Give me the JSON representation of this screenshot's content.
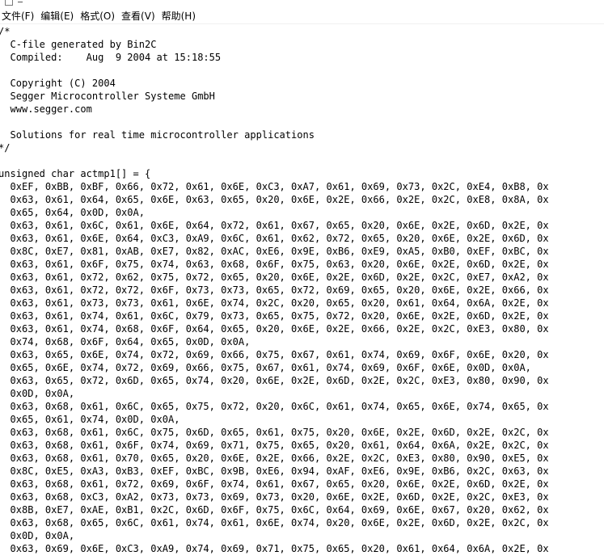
{
  "menu": {
    "items": [
      "文件(F)",
      "编辑(E)",
      "格式(O)",
      "查看(V)",
      "帮助(H)"
    ]
  },
  "editor": {
    "lines": [
      "/*",
      "  C-file generated by Bin2C",
      "  Compiled:    Aug  9 2004 at 15:18:55",
      "",
      "  Copyright (C) 2004",
      "  Segger Microcontroller Systeme GmbH",
      "  www.segger.com",
      "",
      "  Solutions for real time microcontroller applications",
      "*/",
      "",
      "unsigned char actmp1[] = {",
      "  0xEF, 0xBB, 0xBF, 0x66, 0x72, 0x61, 0x6E, 0xC3, 0xA7, 0x61, 0x69, 0x73, 0x2C, 0xE4, 0xB8, 0x",
      "  0x63, 0x61, 0x64, 0x65, 0x6E, 0x63, 0x65, 0x20, 0x6E, 0x2E, 0x66, 0x2E, 0x2C, 0xE8, 0x8A, 0x",
      "  0x65, 0x64, 0x0D, 0x0A,",
      "  0x63, 0x61, 0x6C, 0x61, 0x6E, 0x64, 0x72, 0x61, 0x67, 0x65, 0x20, 0x6E, 0x2E, 0x6D, 0x2E, 0x",
      "  0x63, 0x61, 0x6E, 0x64, 0xC3, 0xA9, 0x6C, 0x61, 0x62, 0x72, 0x65, 0x20, 0x6E, 0x2E, 0x6D, 0x",
      "  0x8C, 0xE7, 0x81, 0xAB, 0xE7, 0x82, 0xAC, 0xE6, 0x9E, 0xB6, 0xE9, 0xA5, 0xB0, 0xEF, 0xBC, 0x",
      "  0x63, 0x61, 0x6F, 0x75, 0x74, 0x63, 0x68, 0x6F, 0x75, 0x63, 0x20, 0x6E, 0x2E, 0x6D, 0x2E, 0x",
      "  0x63, 0x61, 0x72, 0x62, 0x75, 0x72, 0x65, 0x20, 0x6E, 0x2E, 0x6D, 0x2E, 0x2C, 0xE7, 0xA2, 0x",
      "  0x63, 0x61, 0x72, 0x72, 0x6F, 0x73, 0x73, 0x65, 0x72, 0x69, 0x65, 0x20, 0x6E, 0x2E, 0x66, 0x",
      "  0x63, 0x61, 0x73, 0x73, 0x61, 0x6E, 0x74, 0x2C, 0x20, 0x65, 0x20, 0x61, 0x64, 0x6A, 0x2E, 0x",
      "  0x63, 0x61, 0x74, 0x61, 0x6C, 0x79, 0x73, 0x65, 0x75, 0x72, 0x20, 0x6E, 0x2E, 0x6D, 0x2E, 0x",
      "  0x63, 0x61, 0x74, 0x68, 0x6F, 0x64, 0x65, 0x20, 0x6E, 0x2E, 0x66, 0x2E, 0x2C, 0xE3, 0x80, 0x",
      "  0x74, 0x68, 0x6F, 0x64, 0x65, 0x0D, 0x0A,",
      "  0x63, 0x65, 0x6E, 0x74, 0x72, 0x69, 0x66, 0x75, 0x67, 0x61, 0x74, 0x69, 0x6F, 0x6E, 0x20, 0x",
      "  0x65, 0x6E, 0x74, 0x72, 0x69, 0x66, 0x75, 0x67, 0x61, 0x74, 0x69, 0x6F, 0x6E, 0x0D, 0x0A,",
      "  0x63, 0x65, 0x72, 0x6D, 0x65, 0x74, 0x20, 0x6E, 0x2E, 0x6D, 0x2E, 0x2C, 0xE3, 0x80, 0x90, 0x",
      "  0x0D, 0x0A,",
      "  0x63, 0x68, 0x61, 0x6C, 0x65, 0x75, 0x72, 0x20, 0x6C, 0x61, 0x74, 0x65, 0x6E, 0x74, 0x65, 0x",
      "  0x65, 0x61, 0x74, 0x0D, 0x0A,",
      "  0x63, 0x68, 0x61, 0x6C, 0x75, 0x6D, 0x65, 0x61, 0x75, 0x20, 0x6E, 0x2E, 0x6D, 0x2E, 0x2C, 0x",
      "  0x63, 0x68, 0x61, 0x6F, 0x74, 0x69, 0x71, 0x75, 0x65, 0x20, 0x61, 0x64, 0x6A, 0x2E, 0x2C, 0x",
      "  0x63, 0x68, 0x61, 0x70, 0x65, 0x20, 0x6E, 0x2E, 0x66, 0x2E, 0x2C, 0xE3, 0x80, 0x90, 0xE5, 0x",
      "  0x8C, 0xE5, 0xA3, 0xB3, 0xEF, 0xBC, 0x9B, 0xE6, 0x94, 0xAF, 0xE6, 0x9E, 0xB6, 0x2C, 0x63, 0x",
      "  0x63, 0x68, 0x61, 0x72, 0x69, 0x6F, 0x74, 0x61, 0x67, 0x65, 0x20, 0x6E, 0x2E, 0x6D, 0x2E, 0x",
      "  0x63, 0x68, 0xC3, 0xA2, 0x73, 0x73, 0x69, 0x73, 0x20, 0x6E, 0x2E, 0x6D, 0x2E, 0x2C, 0xE3, 0x",
      "  0x8B, 0xE7, 0xAE, 0xB1, 0x2C, 0x6D, 0x6F, 0x75, 0x6C, 0x64, 0x69, 0x6E, 0x67, 0x20, 0x62, 0x",
      "  0x63, 0x68, 0x65, 0x6C, 0x61, 0x74, 0x61, 0x6E, 0x74, 0x20, 0x6E, 0x2E, 0x6D, 0x2E, 0x2C, 0x",
      "  0x0D, 0x0A,",
      "  0x63, 0x69, 0x6E, 0xC3, 0xA9, 0x74, 0x69, 0x71, 0x75, 0x65, 0x20, 0x61, 0x64, 0x6A, 0x2E, 0x"
    ]
  }
}
